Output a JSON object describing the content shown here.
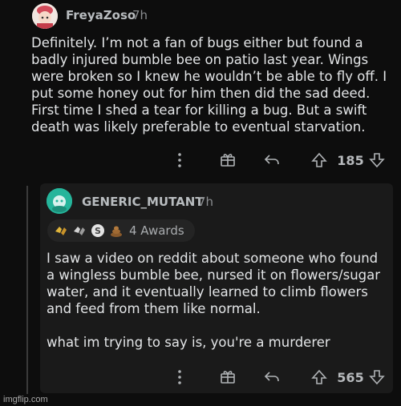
{
  "top_comment": {
    "username": "FreyaZoso",
    "time": "7h",
    "body": "Definitely. I’m not a fan of bugs either but found a badly injured bumble bee on patio last year. Wings were broken so I knew he wouldn’t be able to fly off. I put some honey out for him then did the sad deed. First time I shed a tear for killing a bug. But a swift death was likely preferable to eventual starvation.",
    "votes": "185"
  },
  "reply": {
    "username": "GENERIC_MUTANT",
    "time": "7h",
    "awards_label": "4 Awards",
    "paragraph1": "I saw a video on reddit about someone who found a wingless bumble bee, nursed it on flowers/sugar water, and it eventually learned to climb flowers and feed from them like normal.",
    "paragraph2": "what im trying to say is, you're a murderer",
    "votes": "565"
  },
  "watermark": "imgflip.com",
  "colors": {
    "background": "#0d0d0d",
    "reply_background": "#1a1a1a",
    "avatar2": "#25b59b"
  }
}
